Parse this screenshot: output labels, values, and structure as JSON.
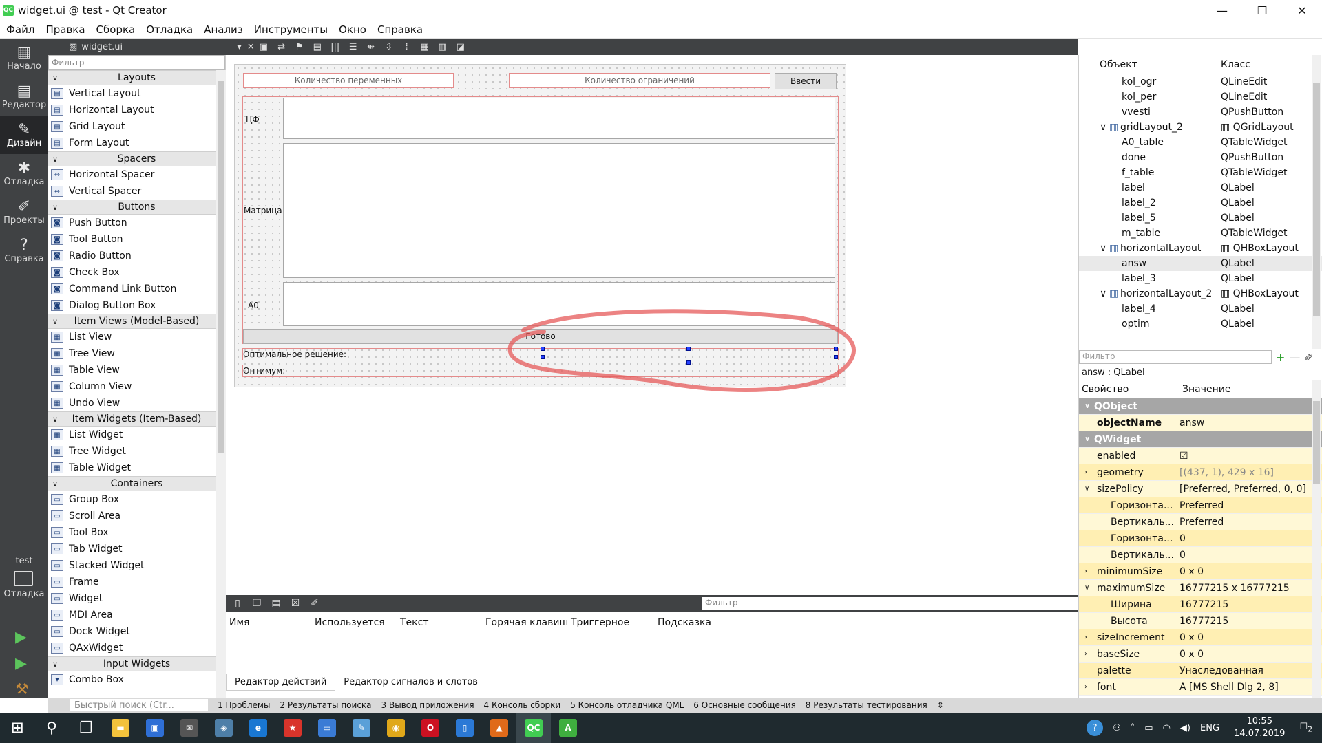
{
  "window": {
    "title": "widget.ui @ test - Qt Creator",
    "app_icon": "QC",
    "controls": [
      "—",
      "❐",
      "✕"
    ]
  },
  "menu": [
    "Файл",
    "Правка",
    "Сборка",
    "Отладка",
    "Анализ",
    "Инструменты",
    "Окно",
    "Справка"
  ],
  "modes": [
    {
      "icon": "grid-icon",
      "glyph": "▦",
      "label": "Начало"
    },
    {
      "icon": "document-icon",
      "glyph": "▤",
      "label": "Редактор"
    },
    {
      "icon": "pencil-icon",
      "glyph": "✎",
      "label": "Дизайн"
    },
    {
      "icon": "bug-icon",
      "glyph": "✱",
      "label": "Отладка"
    },
    {
      "icon": "wrench-icon",
      "glyph": "✐",
      "label": "Проекты"
    },
    {
      "icon": "help-icon",
      "glyph": "?",
      "label": "Справка"
    }
  ],
  "target": {
    "project": "test",
    "mode": "Отладка"
  },
  "document": {
    "file": "widget.ui",
    "close": "✕"
  },
  "widget_box": {
    "filter_placeholder": "Фильтр",
    "categories": [
      {
        "name": "Layouts",
        "items": [
          "Vertical Layout",
          "Horizontal Layout",
          "Grid Layout",
          "Form Layout"
        ]
      },
      {
        "name": "Spacers",
        "items": [
          "Horizontal Spacer",
          "Vertical Spacer"
        ]
      },
      {
        "name": "Buttons",
        "items": [
          "Push Button",
          "Tool Button",
          "Radio Button",
          "Check Box",
          "Command Link Button",
          "Dialog Button Box"
        ]
      },
      {
        "name": "Item Views (Model-Based)",
        "items": [
          "List View",
          "Tree View",
          "Table View",
          "Column View",
          "Undo View"
        ]
      },
      {
        "name": "Item Widgets (Item-Based)",
        "items": [
          "List Widget",
          "Tree Widget",
          "Table Widget"
        ]
      },
      {
        "name": "Containers",
        "items": [
          "Group Box",
          "Scroll Area",
          "Tool Box",
          "Tab Widget",
          "Stacked Widget",
          "Frame",
          "Widget",
          "MDI Area",
          "Dock Widget",
          "QAxWidget"
        ]
      },
      {
        "name": "Input Widgets",
        "items": [
          "Combo Box"
        ]
      }
    ]
  },
  "form": {
    "kol_per_placeholder": "Количество переменных",
    "kol_ogr_placeholder": "Количество ограничений",
    "vvesti": "Ввести",
    "label_cf": "ЦФ",
    "label_matrix": "Матрица",
    "label_a0": "А0",
    "done": "Готово",
    "label_opt": "Оптимальное решение:",
    "label_optimum": "Оптимум:"
  },
  "action_editor": {
    "filter_placeholder": "Фильтр",
    "columns": [
      "Имя",
      "Используется",
      "Текст",
      "Горячая клавиш",
      "Триггерное",
      "Подсказка"
    ],
    "tabs": [
      "Редактор действий",
      "Редактор сигналов и слотов"
    ]
  },
  "object_inspector": {
    "headers": [
      "Объект",
      "Класс"
    ],
    "rows": [
      {
        "name": "kol_ogr",
        "cls": "QLineEdit",
        "level": 1
      },
      {
        "name": "kol_per",
        "cls": "QLineEdit",
        "level": 1
      },
      {
        "name": "vvesti",
        "cls": "QPushButton",
        "level": 1
      },
      {
        "name": "gridLayout_2",
        "cls": "QGridLayout",
        "level": 0,
        "expander": "∨"
      },
      {
        "name": "A0_table",
        "cls": "QTableWidget",
        "level": 1
      },
      {
        "name": "done",
        "cls": "QPushButton",
        "level": 1
      },
      {
        "name": "f_table",
        "cls": "QTableWidget",
        "level": 1
      },
      {
        "name": "label",
        "cls": "QLabel",
        "level": 1
      },
      {
        "name": "label_2",
        "cls": "QLabel",
        "level": 1
      },
      {
        "name": "label_5",
        "cls": "QLabel",
        "level": 1
      },
      {
        "name": "m_table",
        "cls": "QTableWidget",
        "level": 1
      },
      {
        "name": "horizontalLayout",
        "cls": "QHBoxLayout",
        "level": 0,
        "expander": "∨"
      },
      {
        "name": "answ",
        "cls": "QLabel",
        "level": 1,
        "selected": true
      },
      {
        "name": "label_3",
        "cls": "QLabel",
        "level": 1
      },
      {
        "name": "horizontalLayout_2",
        "cls": "QHBoxLayout",
        "level": 0,
        "expander": "∨"
      },
      {
        "name": "label_4",
        "cls": "QLabel",
        "level": 1
      },
      {
        "name": "optim",
        "cls": "QLabel",
        "level": 1
      }
    ]
  },
  "property_editor": {
    "filter_placeholder": "Фильтр",
    "object_line": "answ : QLabel",
    "headers": [
      "Свойство",
      "Значение"
    ],
    "rows": [
      {
        "name": "QObject",
        "value": "",
        "type": "group"
      },
      {
        "name": "objectName",
        "value": "answ",
        "type": "bold"
      },
      {
        "name": "QWidget",
        "value": "",
        "type": "group"
      },
      {
        "name": "enabled",
        "value": "☑",
        "type": "plain"
      },
      {
        "name": "geometry",
        "value": "[(437, 1), 429 x 16]",
        "type": "dim",
        "exp": "›"
      },
      {
        "name": "sizePolicy",
        "value": "[Preferred, Preferred, 0, 0]",
        "type": "plain",
        "exp": "∨"
      },
      {
        "name": "Горизонта...",
        "value": "Preferred",
        "type": "sub"
      },
      {
        "name": "Вертикаль...",
        "value": "Preferred",
        "type": "sub"
      },
      {
        "name": "Горизонта...",
        "value": "0",
        "type": "sub"
      },
      {
        "name": "Вертикаль...",
        "value": "0",
        "type": "sub"
      },
      {
        "name": "minimumSize",
        "value": "0 x 0",
        "type": "plain",
        "exp": "›"
      },
      {
        "name": "maximumSize",
        "value": "16777215 x 16777215",
        "type": "plain",
        "exp": "∨"
      },
      {
        "name": "Ширина",
        "value": "16777215",
        "type": "sub"
      },
      {
        "name": "Высота",
        "value": "16777215",
        "type": "sub"
      },
      {
        "name": "sizeIncrement",
        "value": "0 x 0",
        "type": "plain",
        "exp": "›"
      },
      {
        "name": "baseSize",
        "value": "0 x 0",
        "type": "plain",
        "exp": "›"
      },
      {
        "name": "palette",
        "value": "Унаследованная",
        "type": "plain"
      },
      {
        "name": "font",
        "value": "A [MS Shell Dlg 2, 8]",
        "type": "plain",
        "exp": "›"
      }
    ]
  },
  "status_bar": {
    "quick_search": "Быстрый поиск (Ctr...",
    "panes": [
      "1 Проблемы",
      "2 Результаты поиска",
      "3 Вывод приложения",
      "4 Консоль сборки",
      "5 Консоль отладчика QML",
      "6 Основные сообщения",
      "8 Результаты тестирования"
    ]
  },
  "taskbar": {
    "apps": [
      {
        "icon": "windows-start-icon",
        "glyph": "⊞",
        "color": "#1f2a2f"
      },
      {
        "icon": "search-icon",
        "glyph": "⚲",
        "color": "#1f2a2f"
      },
      {
        "icon": "task-view-icon",
        "glyph": "❐",
        "color": "#1f2a2f"
      },
      {
        "icon": "file-explorer-icon",
        "glyph": "▬",
        "color": "#f3c23c"
      },
      {
        "icon": "store-icon",
        "glyph": "▣",
        "color": "#2f6fd6"
      },
      {
        "icon": "mail-icon",
        "glyph": "✉",
        "color": "#555555"
      },
      {
        "icon": "network-icon",
        "glyph": "◈",
        "color": "#4e7fa8"
      },
      {
        "icon": "edge-icon",
        "glyph": "e",
        "color": "#1977d2"
      },
      {
        "icon": "app-red-icon",
        "glyph": "★",
        "color": "#d9342b"
      },
      {
        "icon": "remote-desktop-icon",
        "glyph": "▭",
        "color": "#3a7bd5"
      },
      {
        "icon": "notepad-icon",
        "glyph": "✎",
        "color": "#5aa0d8"
      },
      {
        "icon": "chrome-icon",
        "glyph": "◉",
        "color": "#e0a81a"
      },
      {
        "icon": "opera-icon",
        "glyph": "O",
        "color": "#cc1122"
      },
      {
        "icon": "document-app-icon",
        "glyph": "▯",
        "color": "#2b79d6"
      },
      {
        "icon": "matlab-icon",
        "glyph": "▲",
        "color": "#e06a1a"
      },
      {
        "icon": "qt-creator-icon",
        "glyph": "QC",
        "color": "#41cd52"
      },
      {
        "icon": "android-app-icon",
        "glyph": "A",
        "color": "#3fae3f"
      }
    ],
    "tray": {
      "lang": "ENG",
      "time": "10:55",
      "date": "14.07.2019",
      "notifications": "2"
    }
  }
}
